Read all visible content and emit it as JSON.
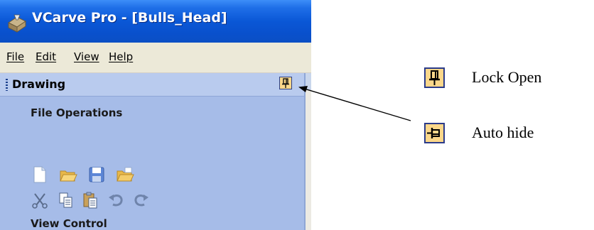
{
  "window": {
    "title": "VCarve Pro - [Bulls_Head]",
    "accent_color": "#0a57d6"
  },
  "menu": {
    "items": [
      "File",
      "Edit",
      "View",
      "Help"
    ]
  },
  "panel": {
    "header": "Drawing",
    "pin_icon": "pin-lock-open-icon",
    "sections": {
      "file_operations": "File Operations",
      "view_control": "View Control"
    },
    "file_tools": [
      "new-file-icon",
      "open-file-icon",
      "save-file-icon",
      "import-file-icon"
    ],
    "edit_tools": [
      "cut-icon",
      "copy-icon",
      "paste-icon",
      "undo-icon",
      "redo-icon"
    ]
  },
  "legend": {
    "lock_open": {
      "icon": "pin-lock-open-icon",
      "label": "Lock Open"
    },
    "auto_hide": {
      "icon": "pin-auto-hide-icon",
      "label": "Auto hide"
    }
  }
}
